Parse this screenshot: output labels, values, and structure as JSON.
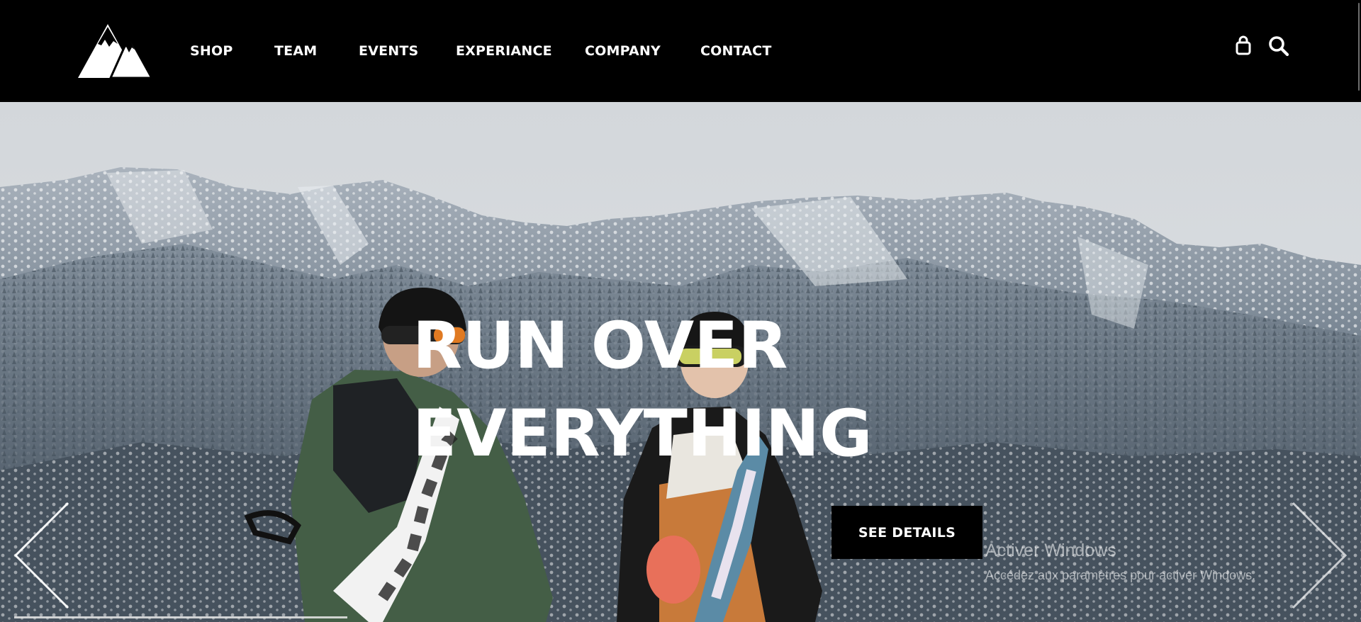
{
  "header": {
    "logo_name": "mountain-logo",
    "nav": [
      {
        "label": "SHOP"
      },
      {
        "label": "TEAM"
      },
      {
        "label": "EVENTS"
      },
      {
        "label": "EXPERIANCE"
      },
      {
        "label": "COMPANY"
      },
      {
        "label": "CONTACT"
      }
    ],
    "icons": {
      "cart": "shopping-bag-icon",
      "search": "search-icon"
    }
  },
  "hero": {
    "headline_line1": "RUN OVER",
    "headline_line2": "EVERYTHING",
    "cta_label": "SEE DETAILS",
    "prev_icon": "chevron-left-icon",
    "next_icon": "chevron-right-icon",
    "progress": 0.25
  },
  "watermark": {
    "title": "Activer Windows",
    "subtitle": "Accédez aux paramètres pour activer Windows."
  },
  "colors": {
    "header_bg": "#000000",
    "nav_text": "#ffffff",
    "cta_bg": "#000000",
    "sky": "#d6dadd"
  }
}
